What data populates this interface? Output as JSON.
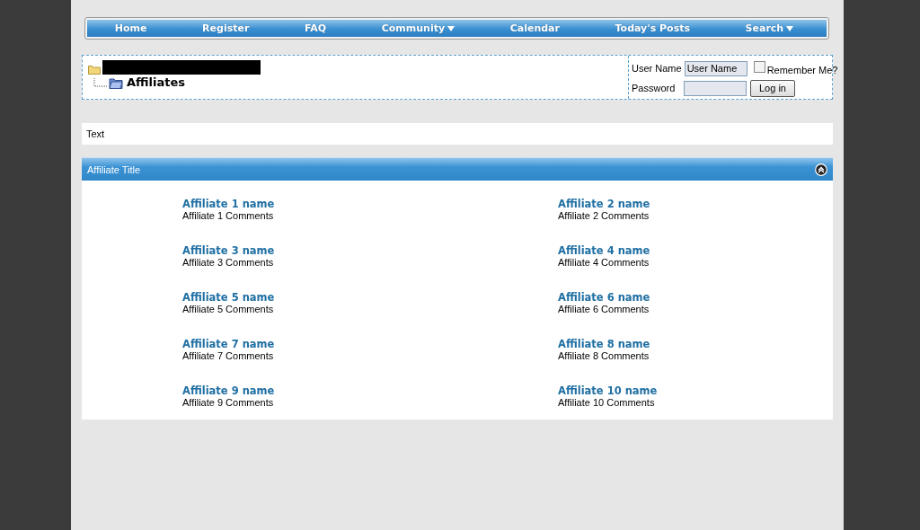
{
  "navbar": {
    "items": [
      {
        "label": "Home",
        "has_menu": false
      },
      {
        "label": "Register",
        "has_menu": false
      },
      {
        "label": "FAQ",
        "has_menu": false
      },
      {
        "label": "Community",
        "has_menu": true
      },
      {
        "label": "Calendar",
        "has_menu": false
      },
      {
        "label": "Today's Posts",
        "has_menu": false
      },
      {
        "label": "Search",
        "has_menu": true
      }
    ]
  },
  "breadcrumb": {
    "current": "Affiliates"
  },
  "login": {
    "username_label": "User Name",
    "username_value": "User Name",
    "remember_label": "Remember Me?",
    "remember_checked": false,
    "password_label": "Password",
    "button": "Log in"
  },
  "notice": {
    "text": "Text"
  },
  "affiliates": {
    "title": "Affiliate Title",
    "items": [
      {
        "name": "Affiliate 1 name",
        "comments": "Affiliate 1 Comments"
      },
      {
        "name": "Affiliate 2 name",
        "comments": "Affiliate 2 Comments"
      },
      {
        "name": "Affiliate 3 name",
        "comments": "Affiliate 3 Comments"
      },
      {
        "name": "Affiliate 4 name",
        "comments": "Affiliate 4 Comments"
      },
      {
        "name": "Affiliate 5 name",
        "comments": "Affiliate 5 Comments"
      },
      {
        "name": "Affiliate 6 name",
        "comments": "Affiliate 6 Comments"
      },
      {
        "name": "Affiliate 7 name",
        "comments": "Affiliate 7 Comments"
      },
      {
        "name": "Affiliate 8 name",
        "comments": "Affiliate 8 Comments"
      },
      {
        "name": "Affiliate 9 name",
        "comments": "Affiliate 9 Comments"
      },
      {
        "name": "Affiliate 10 name",
        "comments": "Affiliate 10 Comments"
      }
    ]
  }
}
